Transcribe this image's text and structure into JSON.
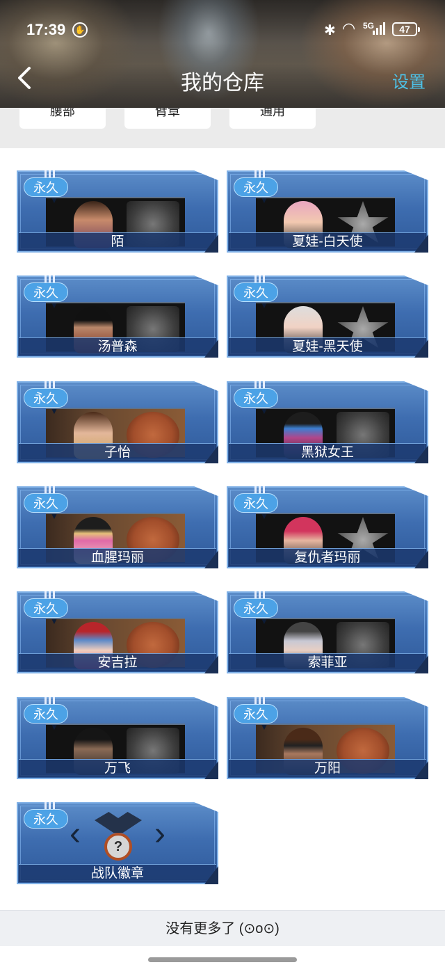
{
  "status_bar": {
    "time": "17:39",
    "network": "5G",
    "battery": "47"
  },
  "header": {
    "title": "我的仓库",
    "settings_label": "设置"
  },
  "tabs": [
    {
      "label": "腰部"
    },
    {
      "label": "臂章"
    },
    {
      "label": "通用"
    }
  ],
  "items": [
    {
      "tag": "永久",
      "name": "陌",
      "emblem": "dagger-emblem",
      "bg": "dark"
    },
    {
      "tag": "永久",
      "name": "夏娃-白天使",
      "emblem": "star-emblem",
      "bg": "dark"
    },
    {
      "tag": "永久",
      "name": "汤普森",
      "emblem": "dagger-emblem",
      "bg": "dark"
    },
    {
      "tag": "永久",
      "name": "夏娃-黑天使",
      "emblem": "star-emblem",
      "bg": "dark"
    },
    {
      "tag": "永久",
      "name": "子怡",
      "emblem": "fist-emblem",
      "bg": "warm"
    },
    {
      "tag": "永久",
      "name": "黑狱女王",
      "emblem": "dagger-emblem",
      "bg": "dark"
    },
    {
      "tag": "永久",
      "name": "血腥玛丽",
      "emblem": "fist-emblem",
      "bg": "warm"
    },
    {
      "tag": "永久",
      "name": "复仇者玛丽",
      "emblem": "star-emblem",
      "bg": "dark"
    },
    {
      "tag": "永久",
      "name": "安吉拉",
      "emblem": "fist-emblem",
      "bg": "warm"
    },
    {
      "tag": "永久",
      "name": "索菲亚",
      "emblem": "dagger-emblem",
      "bg": "dark"
    },
    {
      "tag": "永久",
      "name": "万飞",
      "emblem": "dagger-emblem",
      "bg": "dark"
    },
    {
      "tag": "永久",
      "name": "万阳",
      "emblem": "fist-emblem",
      "bg": "warm"
    },
    {
      "tag": "永久",
      "name": "战队徽章",
      "emblem": "squad-badge",
      "bg": "none"
    }
  ],
  "squad_badge_glyph": "?",
  "footer": {
    "text": "没有更多了 (⊙o⊙)"
  },
  "colors": {
    "accent": "#4dc2e8",
    "card_blue": "#3e6db0",
    "badge_blue": "#4ca2e6"
  }
}
